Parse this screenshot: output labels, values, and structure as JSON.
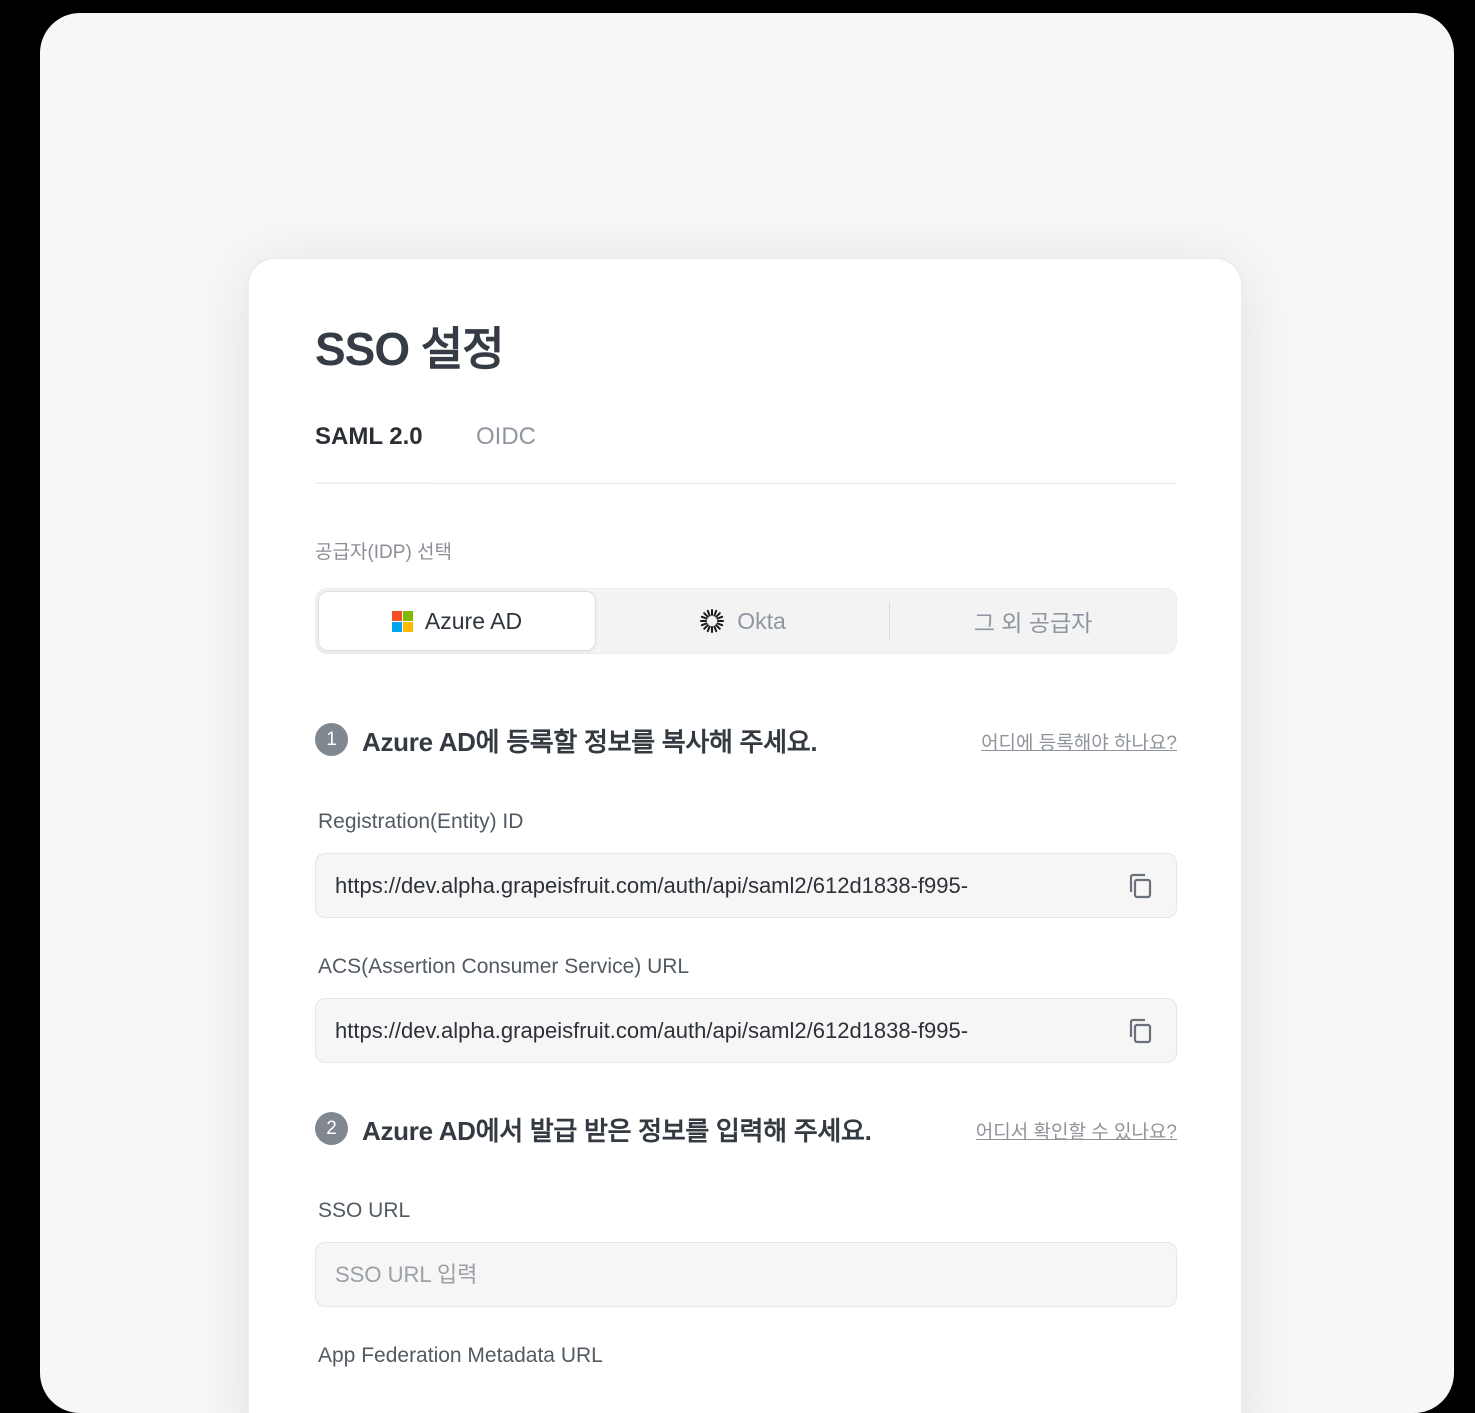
{
  "card": {
    "title": "SSO 설정",
    "tabs": [
      {
        "label": "SAML 2.0",
        "active": true
      },
      {
        "label": "OIDC",
        "active": false
      }
    ],
    "idp_label": "공급자(IDP) 선택",
    "idp_options": [
      {
        "label": "Azure AD",
        "icon": "microsoft-icon",
        "selected": true
      },
      {
        "label": "Okta",
        "icon": "okta-icon",
        "selected": false
      },
      {
        "label": "그 외 공급자",
        "selected": false
      }
    ],
    "step1": {
      "number": "1",
      "title": "Azure AD에 등록할 정보를 복사해 주세요.",
      "link": "어디에 등록해야 하나요?",
      "fields": [
        {
          "label": "Registration(Entity) ID",
          "value": "https://dev.alpha.grapeisfruit.com/auth/api/saml2/612d1838-f995-",
          "icon": "copy-icon"
        },
        {
          "label": "ACS(Assertion Consumer Service) URL",
          "value": "https://dev.alpha.grapeisfruit.com/auth/api/saml2/612d1838-f995-",
          "icon": "copy-icon"
        }
      ]
    },
    "step2": {
      "number": "2",
      "title": "Azure AD에서 발급 받은 정보를 입력해 주세요.",
      "link": "어디서 확인할 수 있나요?",
      "fields": [
        {
          "label": "SSO URL",
          "placeholder": "SSO URL 입력"
        },
        {
          "label": "App Federation Metadata URL"
        }
      ]
    }
  },
  "colors": {
    "ms_red": "#f25022",
    "ms_green": "#7fba00",
    "ms_blue": "#00a4ef",
    "ms_yellow": "#ffb900",
    "step_badge": "#818790"
  }
}
